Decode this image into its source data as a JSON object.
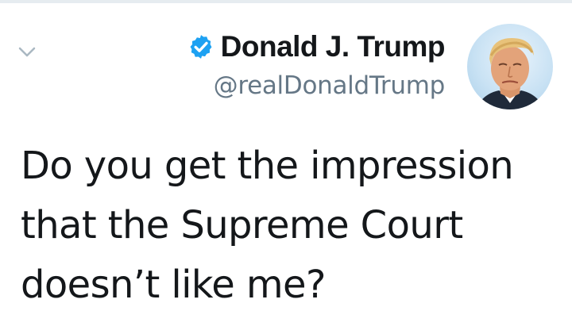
{
  "author": {
    "display_name": "Donald J. Trump",
    "handle": "@realDonaldTrump",
    "verified": true
  },
  "tweet": {
    "text": "Do you get the impression\nthat the Supreme Court\ndoesn’t like me?"
  },
  "icons": {
    "caret": "chevron-down-icon",
    "verified": "verified-badge-icon"
  },
  "colors": {
    "verified_blue": "#1da1f2",
    "handle_gray": "#657786",
    "text_black": "#14171a"
  }
}
